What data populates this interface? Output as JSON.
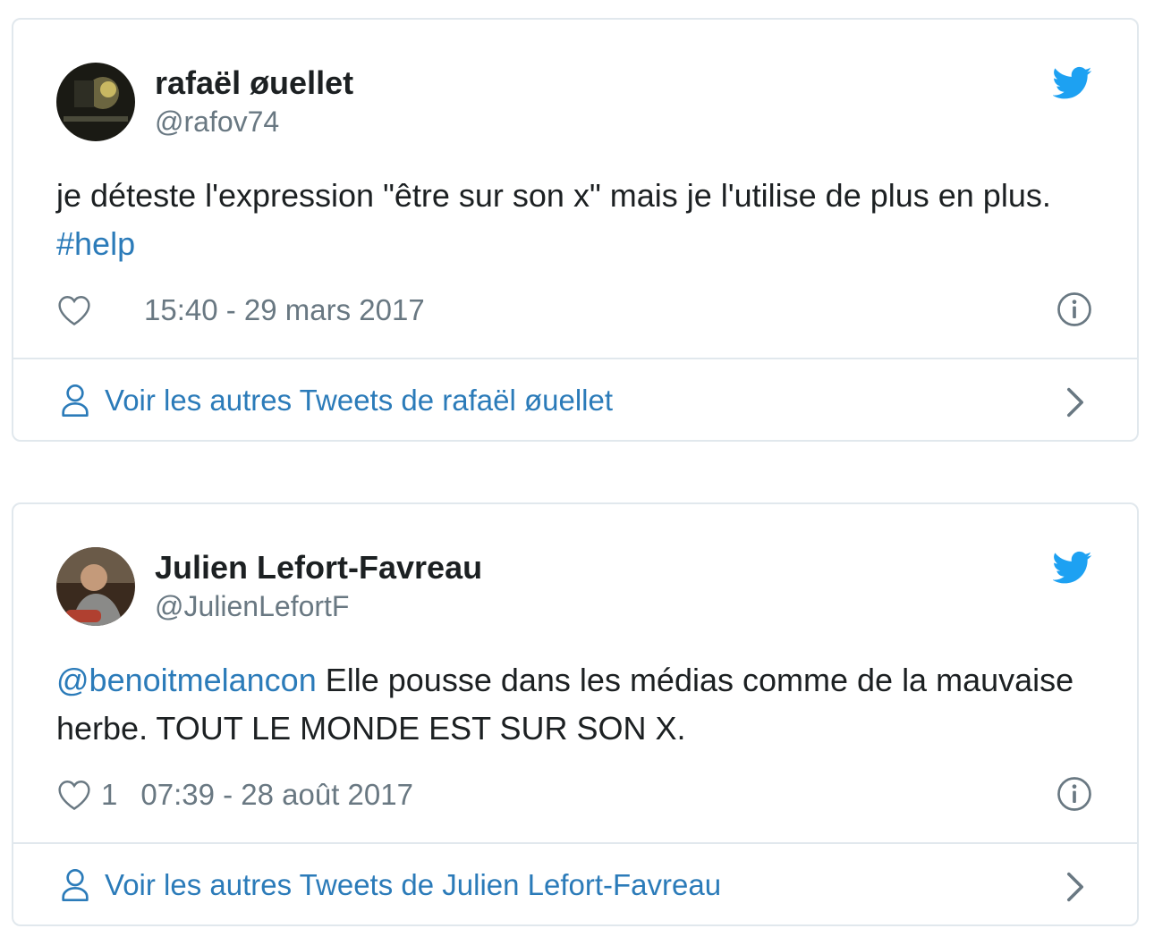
{
  "tweets": [
    {
      "display_name": "rafaël øuellet",
      "handle": "@rafov74",
      "text_before": "je déteste l'expression \"être sur son x\" mais je l'utilise de plus en plus. ",
      "text_link": "#help",
      "text_after": "",
      "like_count": "",
      "timestamp": "15:40 - 29 mars 2017",
      "footer_label": "Voir les autres Tweets de rafaël øuellet"
    },
    {
      "display_name": "Julien Lefort-Favreau",
      "handle": "@JulienLefortF",
      "text_link": "@benoitmelancon",
      "text_after": " Elle pousse dans les médias comme de la mauvaise herbe. TOUT LE MONDE EST SUR SON X.",
      "like_count": "1",
      "timestamp": "07:39 - 28 août 2017",
      "footer_label": "Voir les autres Tweets de Julien Lefort-Favreau"
    }
  ],
  "colors": {
    "link": "#2b7bb9",
    "twitter_blue": "#1da1f2",
    "muted": "#697882",
    "border": "#e1e8ed"
  },
  "icons": [
    "avatar",
    "twitter-bird-icon",
    "heart-icon",
    "info-icon",
    "person-icon",
    "chevron-right-icon"
  ]
}
